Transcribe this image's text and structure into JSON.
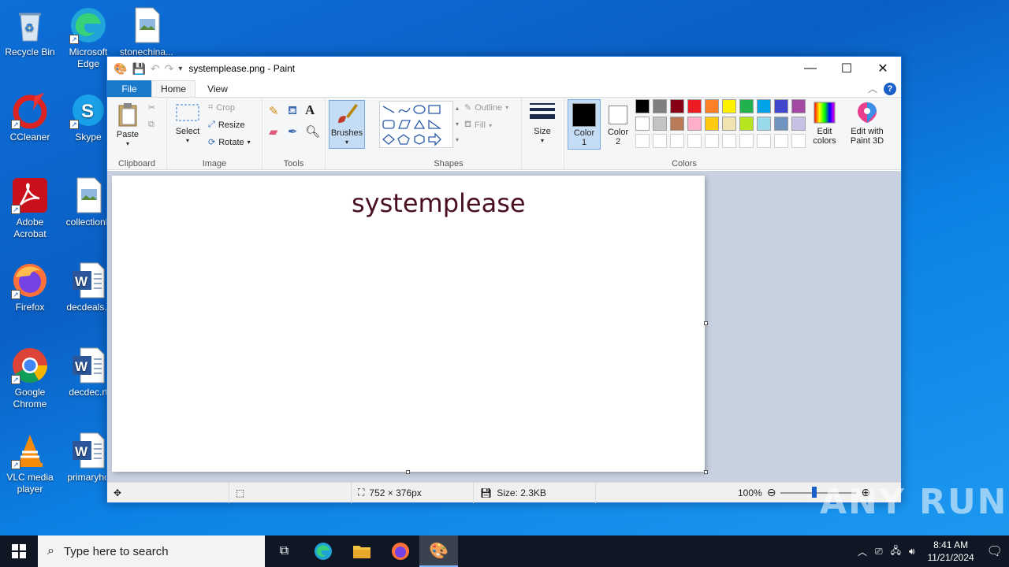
{
  "desktop": {
    "icons": [
      {
        "label": "Recycle Bin"
      },
      {
        "label": "Microsoft Edge"
      },
      {
        "label": "stonechina..."
      },
      {
        "label": "CCleaner"
      },
      {
        "label": "Skype"
      },
      {
        "label": "Adobe Acrobat"
      },
      {
        "label": "collectionb"
      },
      {
        "label": "Firefox"
      },
      {
        "label": "decdeals.r"
      },
      {
        "label": "Google Chrome"
      },
      {
        "label": "decdec.rt"
      },
      {
        "label": "VLC media player"
      },
      {
        "label": "primaryho"
      }
    ]
  },
  "window": {
    "title": "systemplease.png - Paint",
    "tabs": {
      "file": "File",
      "home": "Home",
      "view": "View"
    }
  },
  "ribbon": {
    "clipboard": {
      "label": "Clipboard",
      "paste": "Paste"
    },
    "image": {
      "label": "Image",
      "select": "Select",
      "crop": "Crop",
      "resize": "Resize",
      "rotate": "Rotate"
    },
    "tools": {
      "label": "Tools"
    },
    "brushes": {
      "label": "Brushes"
    },
    "shapes": {
      "label": "Shapes",
      "outline": "Outline",
      "fill": "Fill"
    },
    "size": {
      "label": "Size"
    },
    "colors": {
      "label": "Colors",
      "color1": "Color",
      "color1_num": "1",
      "color2": "Color",
      "color2_num": "2",
      "edit_colors_1": "Edit",
      "edit_colors_2": "colors",
      "edit3d_1": "Edit with",
      "edit3d_2": "Paint 3D",
      "palette_row1": [
        "#000000",
        "#7f7f7f",
        "#880015",
        "#ed1c24",
        "#ff7f27",
        "#fff200",
        "#22b14c",
        "#00a2e8",
        "#3f48cc",
        "#a349a4"
      ],
      "palette_row2": [
        "#ffffff",
        "#c3c3c3",
        "#b97a57",
        "#ffaec9",
        "#ffc90e",
        "#efe4b0",
        "#b5e61d",
        "#99d9ea",
        "#7092be",
        "#c8bfe7"
      ]
    }
  },
  "canvas": {
    "text": "systemplease"
  },
  "status": {
    "dimensions": "752 × 376px",
    "size": "Size: 2.3KB",
    "zoom": "100%"
  },
  "taskbar": {
    "search_placeholder": "Type here to search",
    "time": "8:41 AM",
    "date": "11/21/2024"
  },
  "watermark": "ANY RUN"
}
